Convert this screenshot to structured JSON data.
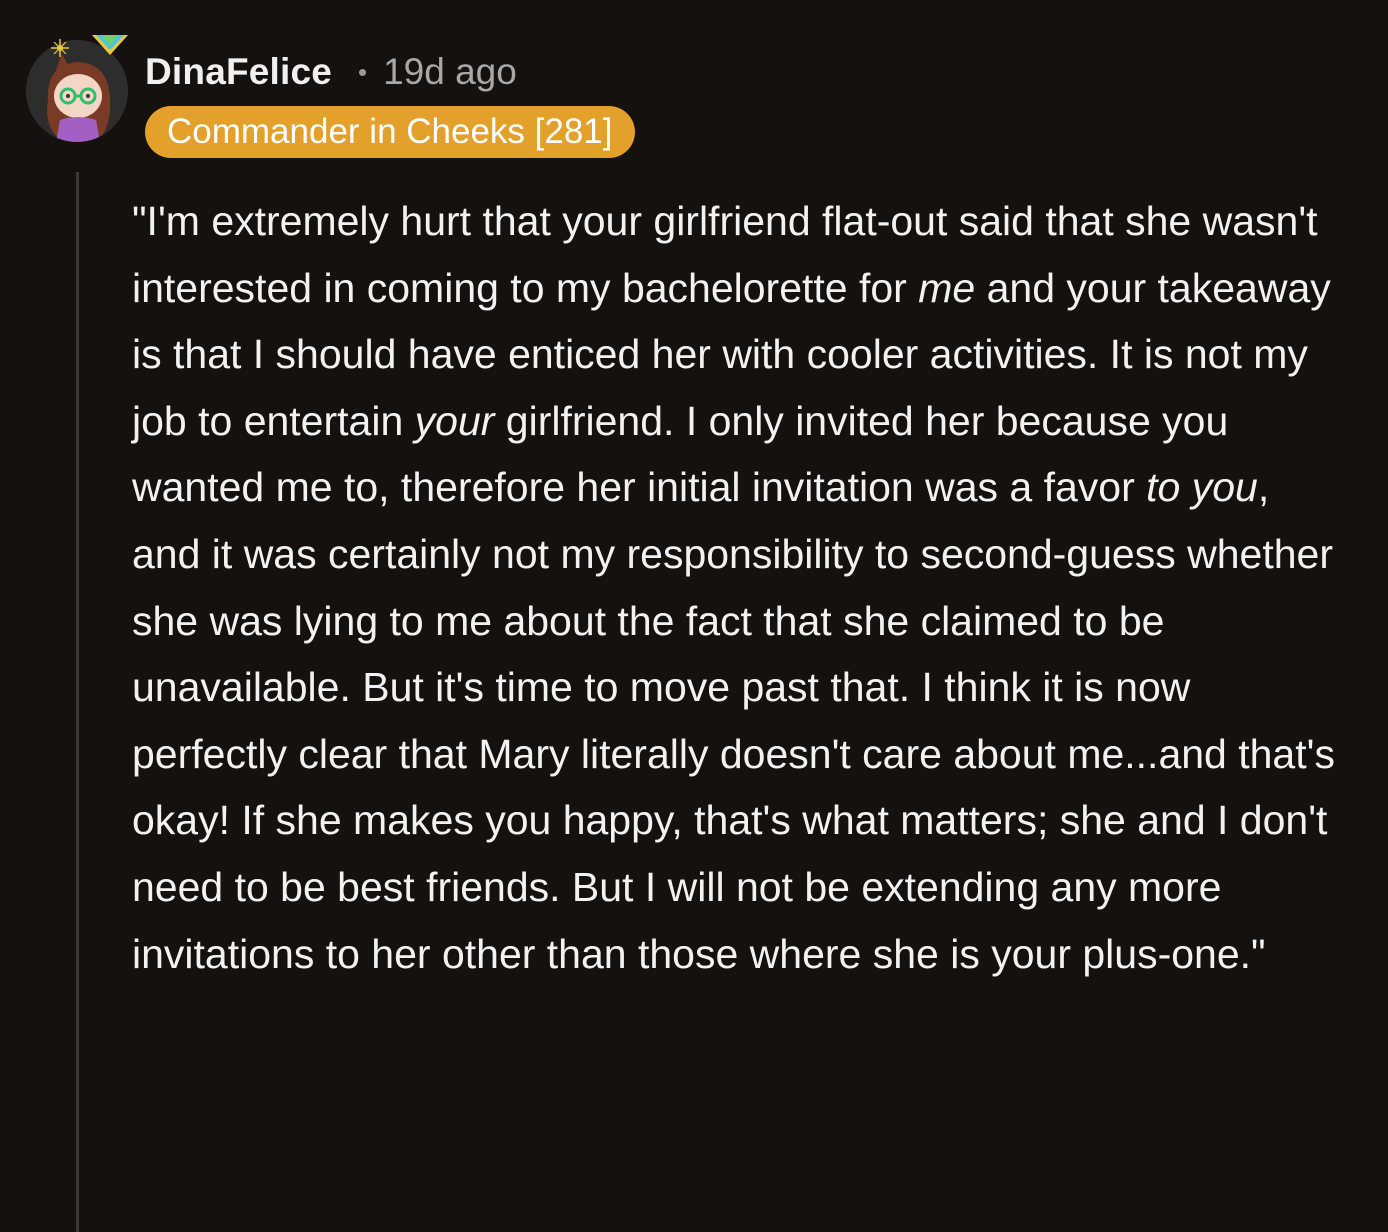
{
  "comment": {
    "author": "DinaFelice",
    "time_ago": "19d ago",
    "flair": "Commander in Cheeks [281]",
    "body": {
      "s1": "\"I'm extremely hurt that your girlfriend flat-out said that she wasn't interested in coming to my bachelorette for ",
      "e1": "me",
      "s2": " and your takeaway is that I should have enticed her with cooler activities. It is not my job to entertain ",
      "e2": "your",
      "s3": " girlfriend. I only invited her because you wanted me to, therefore her initial invitation was a favor ",
      "e3": "to you",
      "s4": ", and it was certainly not my responsibility to second-guess whether she was lying to me about the fact that she claimed to be unavailable. But it's time to move past that. I think it is now perfectly clear that Mary literally doesn't care about me...and that's okay! If she makes you happy, that's what matters; she and I don't need to be best friends. But I will not be extending any more invitations to her other than those where she is your plus-one.\""
    }
  },
  "colors": {
    "background": "#14110f",
    "flair_bg": "#e3a02b",
    "thread_line": "#3a3a3a",
    "timestamp": "#a8a8a8"
  },
  "icons": {
    "avatar": "snoo-avatar-icon",
    "accessory": "rainbow-hat-icon",
    "spark": "sparkle-icon"
  }
}
